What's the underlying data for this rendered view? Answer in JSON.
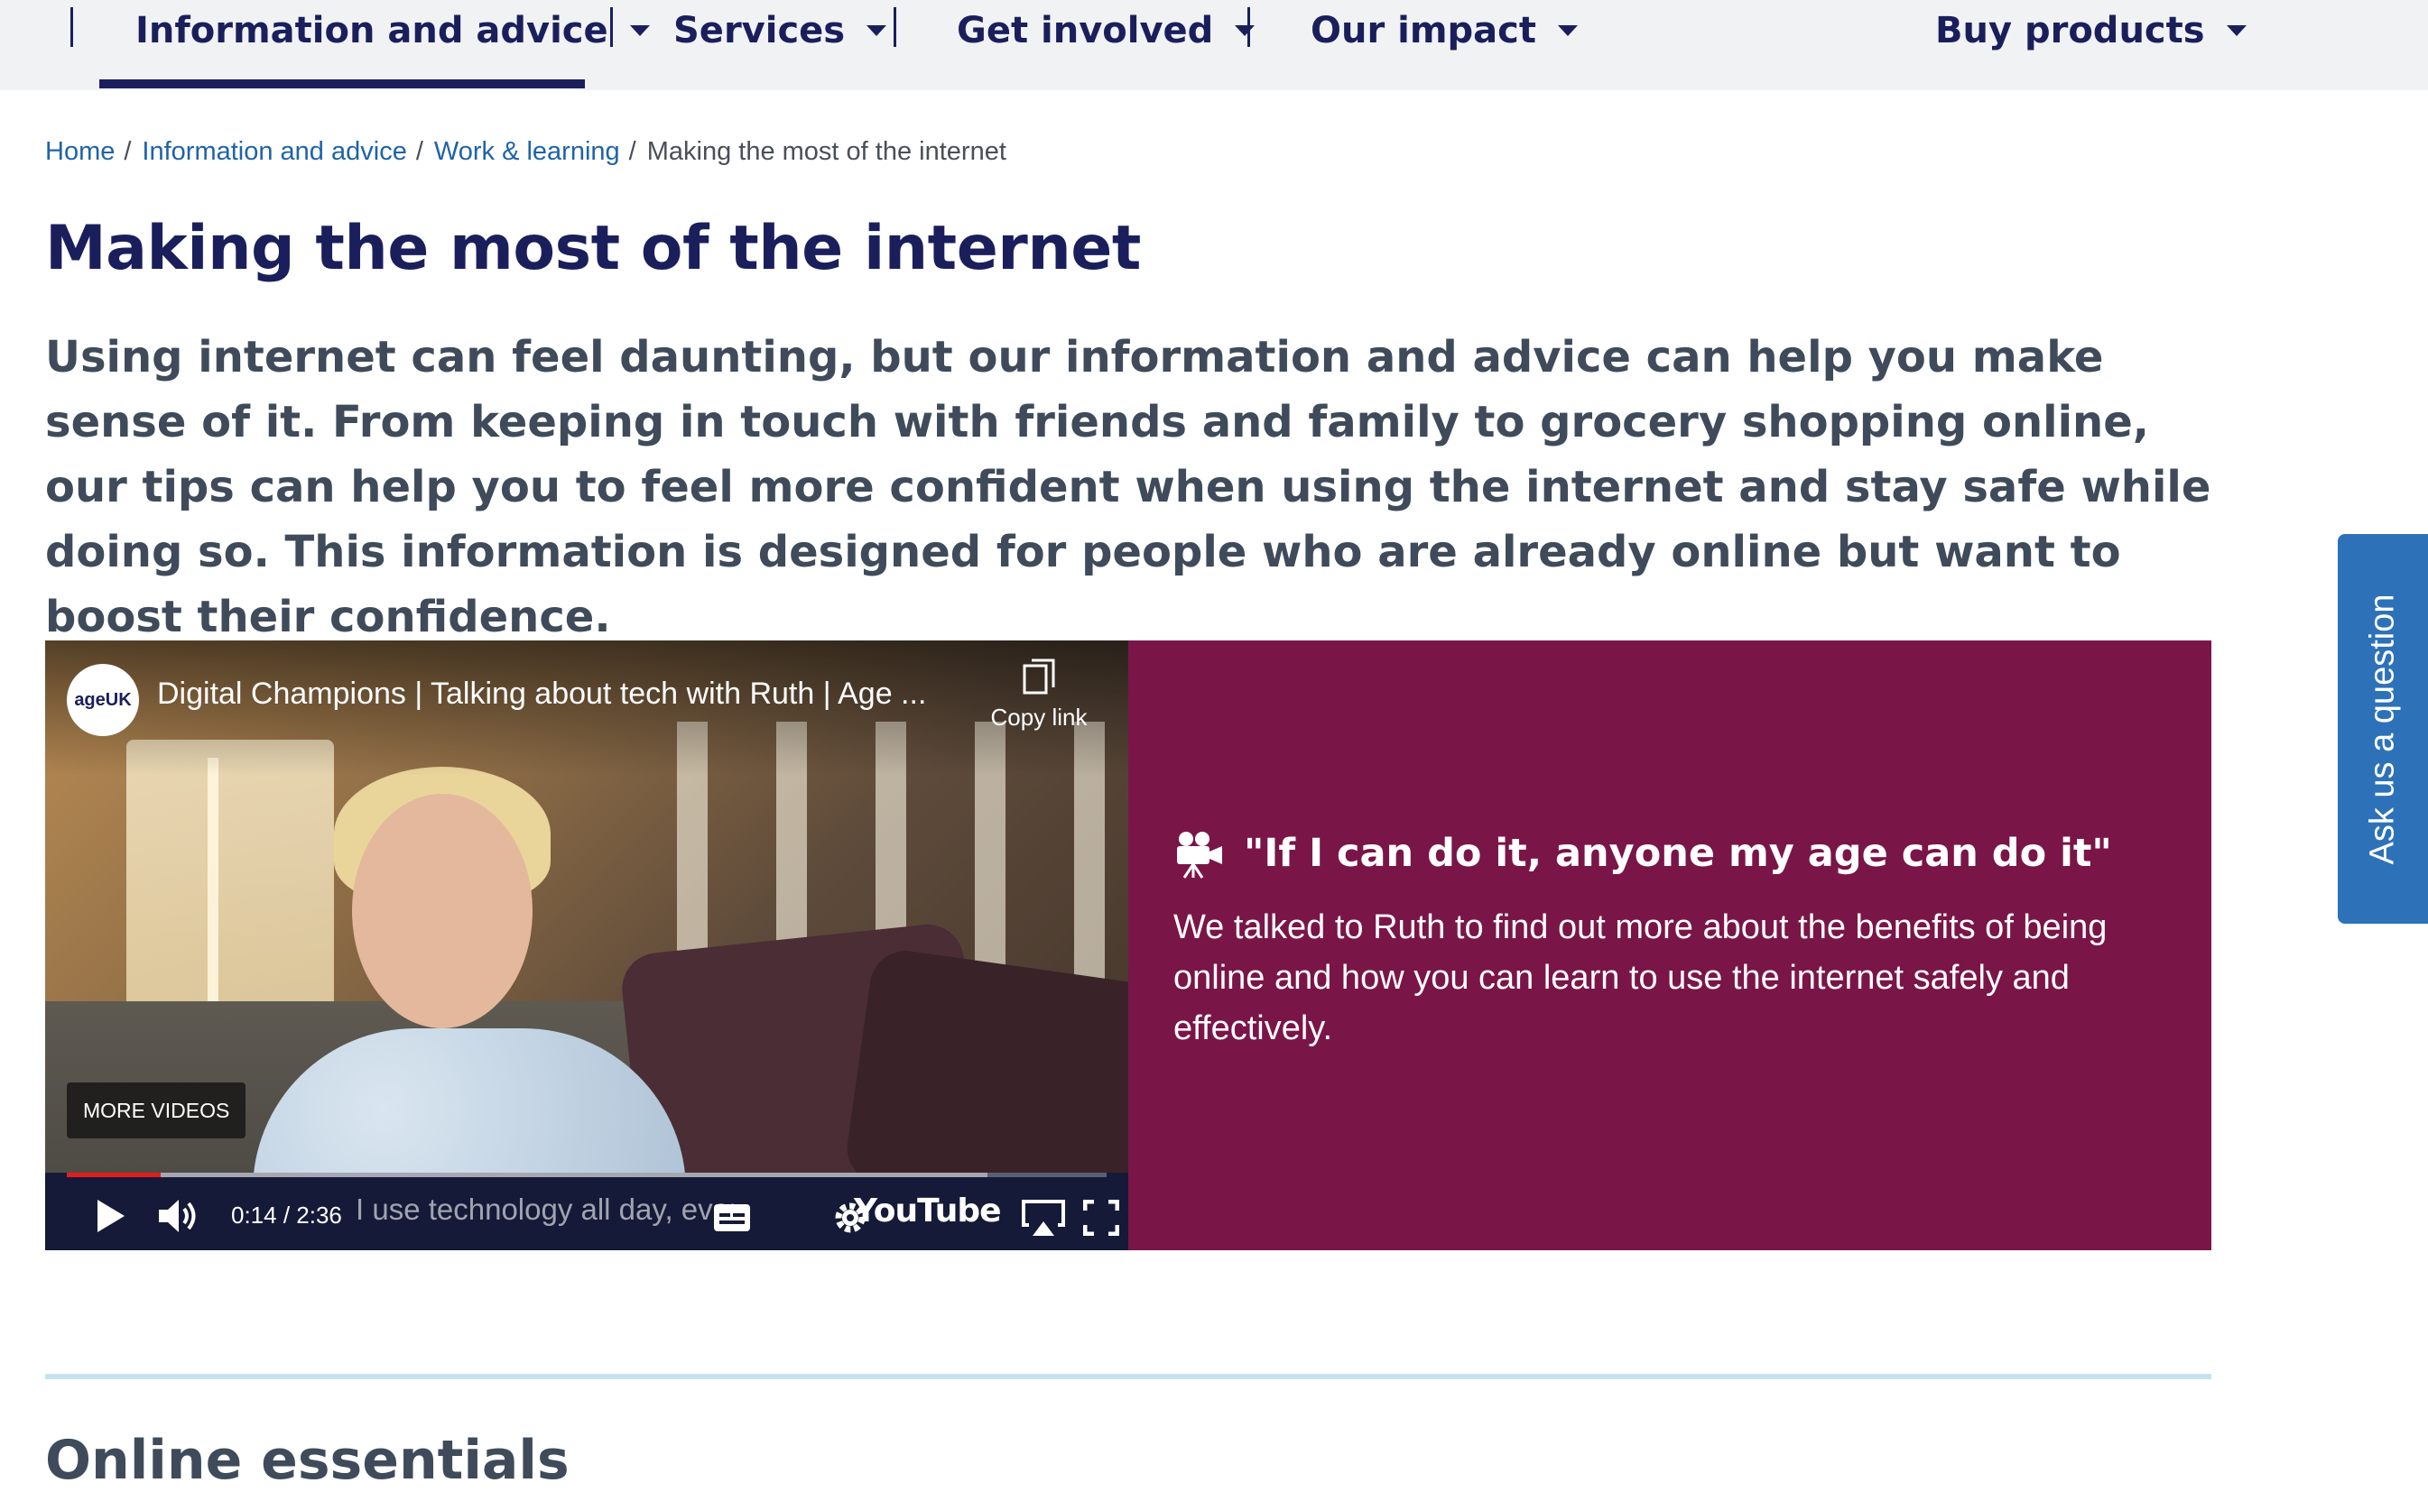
{
  "nav": {
    "items": [
      {
        "label": "Information and advice",
        "active": true
      },
      {
        "label": "Services"
      },
      {
        "label": "Get involved"
      },
      {
        "label": "Our impact"
      },
      {
        "label": "Buy products"
      }
    ]
  },
  "breadcrumb": {
    "links": [
      "Home",
      "Information and advice",
      "Work & learning"
    ],
    "current": "Making the most of the internet",
    "separator": "/"
  },
  "page": {
    "title": "Making the most of the internet",
    "intro": "Using internet can feel daunting, but our information and advice can help you make sense of it. From keeping in touch with friends and family to grocery shopping online, our tips can help you to feel more confident when using the internet and stay safe while doing so. This information is designed for people who are already online but want to boost their confidence."
  },
  "video": {
    "channel_logo": "ageUK",
    "title": "Digital Champions | Talking about tech with Ruth | Age ...",
    "copy_link": "Copy link",
    "more_videos": "MORE VIDEOS",
    "time": "0:14 / 2:36",
    "caption": "I use technology all day, every day",
    "brand": "YouTube",
    "progress_fraction": 0.09,
    "icons": [
      "play-icon",
      "volume-icon",
      "subtitles-icon",
      "settings-icon",
      "airplay-icon",
      "fullscreen-icon",
      "copy-icon"
    ]
  },
  "quote": {
    "heading": "\"If I can do it, anyone my age can do it\"",
    "body": "We talked to Ruth to find out more about the benefits of being online and how you can learn to use the internet safely and effectively.",
    "icon": "video-camera-icon"
  },
  "next_section": {
    "title": "Online essentials"
  },
  "ask_tab": {
    "label": "Ask us a question"
  },
  "colors": {
    "navy": "#1a1f5c",
    "link": "#1f63a8",
    "quote_bg": "#7a1548",
    "ask_tab_bg": "#2d72b8",
    "divider": "#c5e3ee",
    "progress": "#e01e1e"
  }
}
